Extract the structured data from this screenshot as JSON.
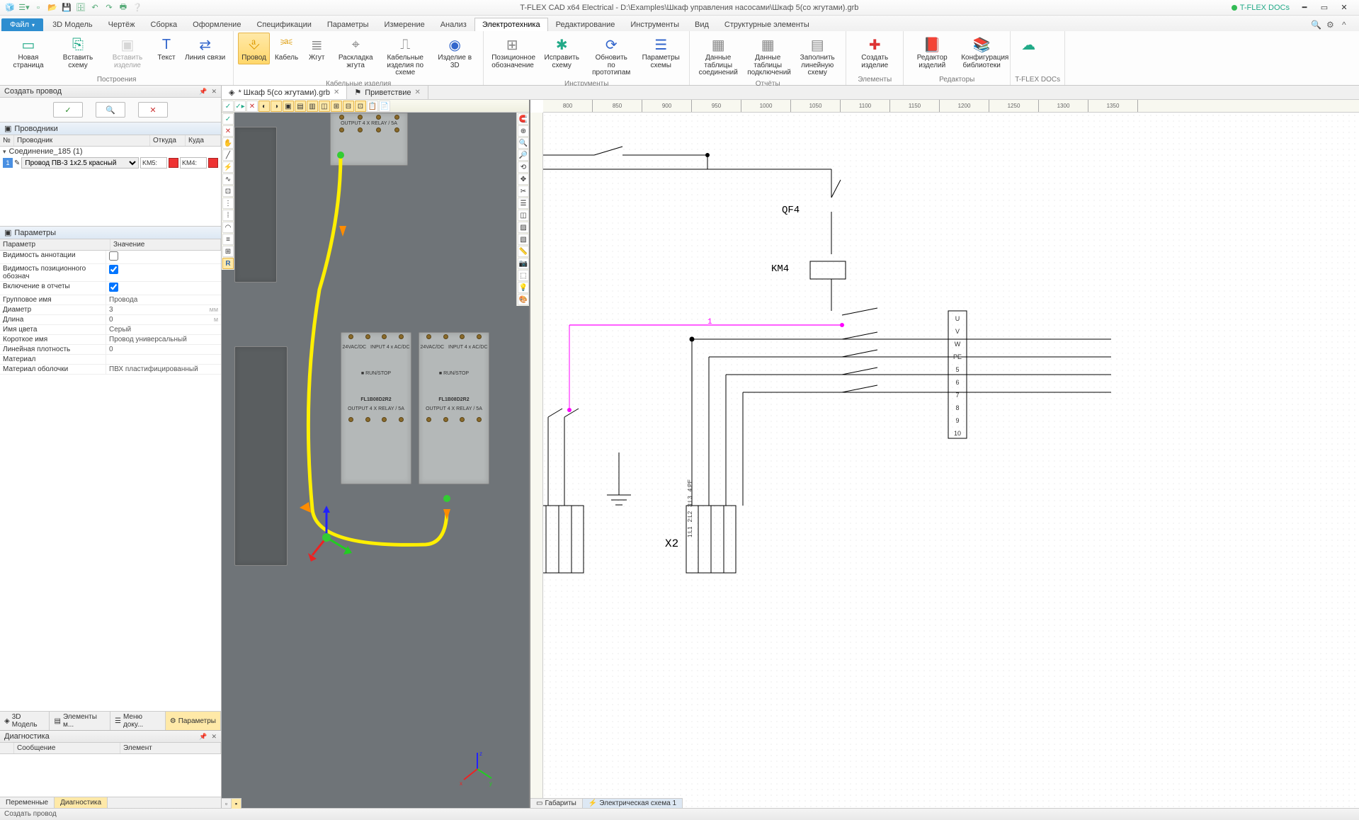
{
  "title": "T-FLEX CAD x64 Electrical - D:\\Examples\\Шкаф управления насосами\\Шкаф 5(со жгутами).grb",
  "docs_label": "T-FLEX DOCs",
  "file_tab": "Файл",
  "tabs": [
    "3D Модель",
    "Чертёж",
    "Сборка",
    "Оформление",
    "Спецификации",
    "Параметры",
    "Измерение",
    "Анализ",
    "Электротехника",
    "Редактирование",
    "Инструменты",
    "Вид",
    "Структурные элементы"
  ],
  "active_tab": "Электротехника",
  "ribbon_groups": {
    "g1": {
      "label": "Построения",
      "items": [
        {
          "name": "new-page",
          "label": "Новая\nстраница",
          "icon": "▭",
          "color": "#2a8"
        },
        {
          "name": "insert-scheme",
          "label": "Вставить\nсхему",
          "icon": "⎘",
          "color": "#2a8"
        },
        {
          "name": "insert-item",
          "label": "Вставить\nизделие",
          "icon": "▣",
          "color": "#aaa",
          "disabled": true
        },
        {
          "name": "text",
          "label": "Текст",
          "icon": "T",
          "color": "#36c"
        },
        {
          "name": "link-line",
          "label": "Линия\nсвязи",
          "icon": "⇄",
          "color": "#36c"
        }
      ]
    },
    "g2": {
      "label": "Кабельные изделия",
      "items": [
        {
          "name": "wire",
          "label": "Провод",
          "icon": "⎀",
          "color": "#d90",
          "hl": true
        },
        {
          "name": "cable",
          "label": "Кабель",
          "icon": "⎃",
          "color": "#d90"
        },
        {
          "name": "harness",
          "label": "Жгут",
          "icon": "≣",
          "color": "#888"
        },
        {
          "name": "harness-layout",
          "label": "Раскладка\nжгута",
          "icon": "⌖",
          "color": "#888"
        },
        {
          "name": "cable-scheme",
          "label": "Кабельные изделия\nпо схеме",
          "icon": "⎍",
          "color": "#888"
        },
        {
          "name": "item-3d",
          "label": "Изделие\nв 3D",
          "icon": "◉",
          "color": "#36c"
        }
      ]
    },
    "g3": {
      "label": "Инструменты",
      "items": [
        {
          "name": "pos-designation",
          "label": "Позиционное\nобозначение",
          "icon": "⊞",
          "color": "#888"
        },
        {
          "name": "fix-scheme",
          "label": "Исправить\nсхему",
          "icon": "✱",
          "color": "#2a8"
        },
        {
          "name": "update-proto",
          "label": "Обновить по\nпрототипам",
          "icon": "⟳",
          "color": "#36c"
        },
        {
          "name": "scheme-params",
          "label": "Параметры\nсхемы",
          "icon": "☰",
          "color": "#36c"
        }
      ]
    },
    "g4": {
      "label": "Отчёты",
      "items": [
        {
          "name": "conn-tables",
          "label": "Данные таблицы\nсоединений",
          "icon": "▦",
          "color": "#888"
        },
        {
          "name": "connport-tables",
          "label": "Данные таблицы\nподключений",
          "icon": "▦",
          "color": "#888"
        },
        {
          "name": "fill-line-scheme",
          "label": "Заполнить\nлинейную схему",
          "icon": "▤",
          "color": "#888"
        }
      ]
    },
    "g5": {
      "label": "Элементы",
      "items": [
        {
          "name": "create-item",
          "label": "Создать\nизделие",
          "icon": "✚",
          "color": "#d33"
        }
      ]
    },
    "g6": {
      "label": "Редакторы",
      "items": [
        {
          "name": "item-editor",
          "label": "Редактор\nизделий",
          "icon": "📕",
          "color": "#a33"
        },
        {
          "name": "lib-config",
          "label": "Конфигурация\nбиблиотеки",
          "icon": "📚",
          "color": "#a33"
        }
      ]
    },
    "g7": {
      "label": "T-FLEX DOCs",
      "items": [
        {
          "name": "tflex-docs",
          "label": "",
          "icon": "☁",
          "color": "#2a8"
        }
      ]
    }
  },
  "left_panel": {
    "title": "Создать провод",
    "ok": "✓",
    "preview": "🔍",
    "cancel": "✕",
    "conductors_title": "Проводники",
    "cond_cols": {
      "n": "№",
      "pr": "Проводник",
      "from": "Откуда",
      "to": "Куда"
    },
    "connection": "Соединение_185  (1)",
    "row": {
      "n": "1",
      "wire": "Провод ПВ-3 1x2.5 красный",
      "from": "KM5:",
      "to": "KM4:"
    },
    "params_title": "Параметры",
    "param_cols": {
      "k": "Параметр",
      "v": "Значение"
    },
    "params": [
      {
        "k": "Видимость аннотации",
        "v": "",
        "type": "check",
        "checked": false
      },
      {
        "k": "Видимость позиционного обознач",
        "v": "",
        "type": "check",
        "checked": true
      },
      {
        "k": "Включение в отчеты",
        "v": "",
        "type": "check",
        "checked": true
      },
      {
        "k": "Групповое имя",
        "v": "Провода"
      },
      {
        "k": "Диаметр",
        "v": "3",
        "unit": "мм"
      },
      {
        "k": "Длина",
        "v": "0",
        "unit": "м"
      },
      {
        "k": "Имя цвета",
        "v": "Серый"
      },
      {
        "k": "Короткое имя",
        "v": "Провод универсальный"
      },
      {
        "k": "Линейная плотность",
        "v": "0"
      },
      {
        "k": "Материал",
        "v": ""
      },
      {
        "k": "Материал оболочки",
        "v": "ПВХ пластифицированный"
      }
    ],
    "tabs": [
      {
        "name": "model3d",
        "label": "3D Модель",
        "icon": "◈"
      },
      {
        "name": "model-elems",
        "label": "Элементы м...",
        "icon": "▤"
      },
      {
        "name": "doc-menu",
        "label": "Меню доку...",
        "icon": "☰"
      },
      {
        "name": "params",
        "label": "Параметры",
        "icon": "⚙",
        "active": true
      }
    ],
    "diag_title": "Диагностика",
    "diag_cols": [
      "",
      "Сообщение",
      "Элемент"
    ],
    "diag_tabs": [
      {
        "label": "Переменные"
      },
      {
        "label": "Диагностика",
        "active": true
      }
    ]
  },
  "doc_tabs": [
    {
      "label": "* Шкаф 5(со жгутами).grb",
      "active": true,
      "icon": "◈"
    },
    {
      "label": "Приветствие",
      "icon": "⚑"
    }
  ],
  "ruler_ticks": [
    "800",
    "850",
    "900",
    "950",
    "1000",
    "1050",
    "1100",
    "1150",
    "1200",
    "1250",
    "1300",
    "1350"
  ],
  "schematic": {
    "qf4": "QF4",
    "km4": "KM4",
    "x2": "X2",
    "one": "1",
    "terms_right": [
      "U",
      "V",
      "W",
      "PE",
      "5",
      "6",
      "7",
      "8",
      "9",
      "10"
    ],
    "terms_x": [
      "1:L1",
      "2:L2",
      "3:L3",
      "4:PE"
    ]
  },
  "view2d_tabs": [
    {
      "label": "Габариты",
      "icon": "▭"
    },
    {
      "label": "Электрическая схема 1",
      "icon": "⚡",
      "active": true
    }
  ],
  "statusbar": "Создать провод"
}
